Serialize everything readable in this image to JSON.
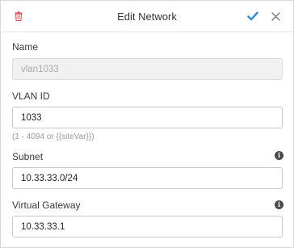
{
  "dialog": {
    "title": "Edit Network",
    "icons": {
      "delete": "trash-icon",
      "save": "checkmark-icon",
      "close": "close-icon",
      "info": "info-icon"
    },
    "colors": {
      "delete": "#e05252",
      "save": "#2a8bd6",
      "close": "#777777"
    }
  },
  "fields": {
    "name": {
      "label": "Name",
      "value": "vlan1033"
    },
    "vlan_id": {
      "label": "VLAN ID",
      "value": "1033",
      "hint": "(1 - 4094 or {{siteVar}})"
    },
    "subnet": {
      "label": "Subnet",
      "value": "10.33.33.0/24"
    },
    "gateway": {
      "label": "Virtual Gateway",
      "value": "10.33.33.1"
    }
  }
}
